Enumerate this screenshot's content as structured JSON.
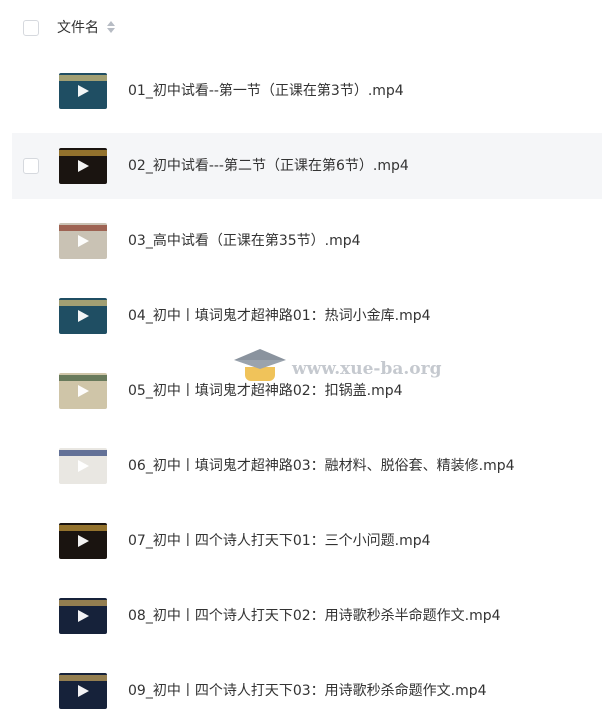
{
  "header": {
    "title": "文件名",
    "sort_icon": "sort-icon"
  },
  "files": [
    {
      "name": "01_初中试看--第一节（正课在第3节）.mp4",
      "thumb_bg": "#1f4e63",
      "thumb_stripe": "#d9c27a"
    },
    {
      "name": "02_初中试看---第二节（正课在第6节）.mp4",
      "thumb_bg": "#1a1410",
      "thumb_stripe": "#c89a3a"
    },
    {
      "name": "03_高中试看（正课在第35节）.mp4",
      "thumb_bg": "#c9c2b4",
      "thumb_stripe": "#8b3a2a"
    },
    {
      "name": "04_初中丨填词鬼才超神路01：热词小金库.mp4",
      "thumb_bg": "#1f4e63",
      "thumb_stripe": "#d9c27a"
    },
    {
      "name": "05_初中丨填词鬼才超神路02：扣锅盖.mp4",
      "thumb_bg": "#cfc5a8",
      "thumb_stripe": "#3c5a3a"
    },
    {
      "name": "06_初中丨填词鬼才超神路03：融材料、脱俗套、精装修.mp4",
      "thumb_bg": "#e9e7e2",
      "thumb_stripe": "#2a3f78"
    },
    {
      "name": "07_初中丨四个诗人打天下01：三个小问题.mp4",
      "thumb_bg": "#1a1410",
      "thumb_stripe": "#c89a3a"
    },
    {
      "name": "08_初中丨四个诗人打天下02：用诗歌秒杀半命题作文.mp4",
      "thumb_bg": "#16223a",
      "thumb_stripe": "#c9a55a"
    },
    {
      "name": "09_初中丨四个诗人打天下03：用诗歌秒杀命题作文.mp4",
      "thumb_bg": "#16223a",
      "thumb_stripe": "#c9a55a"
    }
  ],
  "watermark": {
    "text": "www.xue-ba.org",
    "icon": "graduation-cap-icon"
  },
  "colors": {
    "row_hover": "#f5f6f8",
    "text": "#333333",
    "checkbox_border": "#d6d9de"
  }
}
